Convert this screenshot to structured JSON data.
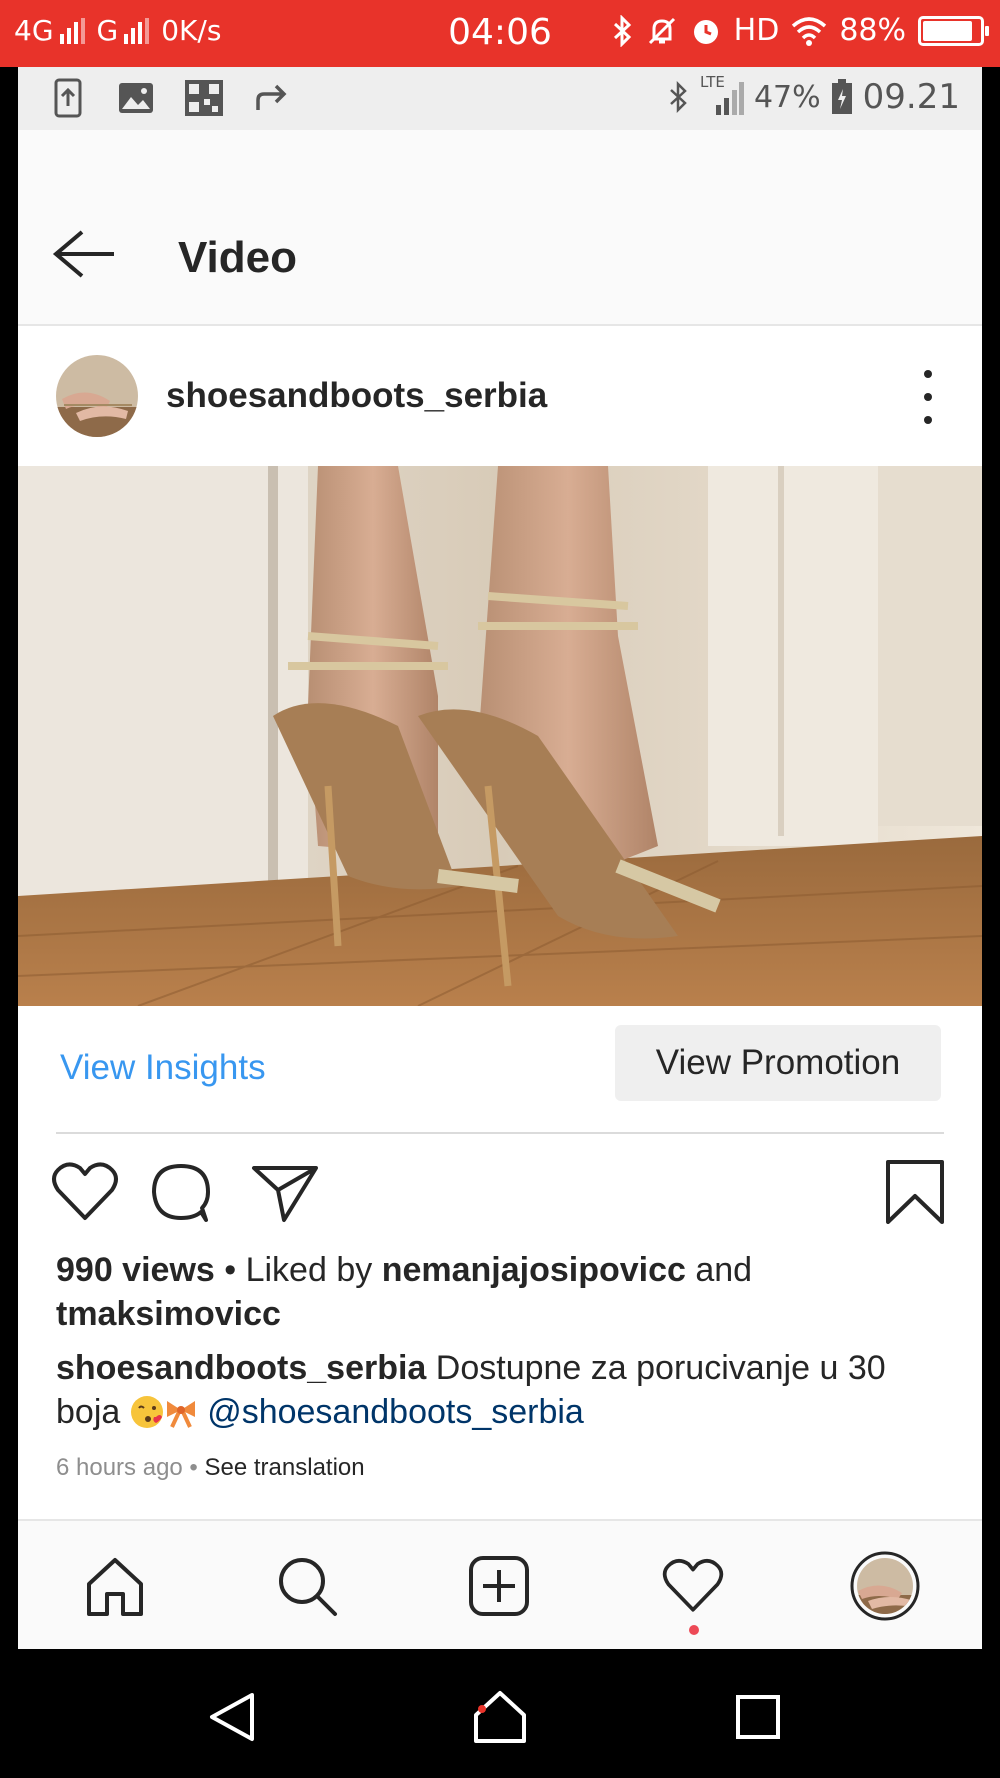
{
  "outer_status": {
    "network": "4G",
    "network2": "G",
    "speed": "0K/s",
    "time": "04:06",
    "hd": "HD",
    "battery": "88%",
    "battery_level": 0.88
  },
  "inner_status": {
    "lte": "LTE",
    "battery": "47%",
    "clock": "09.21"
  },
  "header": {
    "title": "Video"
  },
  "post": {
    "username": "shoesandboots_serbia",
    "insights_label": "View Insights",
    "promotion_label": "View Promotion",
    "views": "990 views",
    "liked_by_prefix": " • Liked by ",
    "liker1": "nemanjajosipovicc",
    "and": " and",
    "liker2": "tmaksimovicc",
    "caption_user": "shoesandboots_serbia",
    "caption_text": " Dostupne za porucivanje u 30 boja ",
    "mention": "@shoesandboots_serbia",
    "time_ago": "6 hours ago",
    "separator": " • ",
    "translate_label": "See translation"
  },
  "icons": {
    "outer": [
      "signal-icon",
      "bluetooth-icon",
      "mute-icon",
      "alarm-icon",
      "wifi-icon",
      "battery-icon"
    ],
    "inner": [
      "upload-icon",
      "image-icon",
      "qr-icon",
      "share-arrow-icon",
      "bluetooth-icon",
      "signal-icon",
      "battery-icon"
    ],
    "actions": [
      "heart-icon",
      "comment-icon",
      "send-icon",
      "bookmark-icon"
    ],
    "tabs": [
      "home-icon",
      "search-icon",
      "add-icon",
      "activity-heart-icon",
      "profile-avatar"
    ],
    "nav": [
      "back-triangle-icon",
      "home-house-icon",
      "recents-square-icon"
    ]
  },
  "colors": {
    "status_red": "#e8332a",
    "link_blue": "#3897f0",
    "mention_blue": "#003569",
    "notification_dot": "#ed4956"
  }
}
